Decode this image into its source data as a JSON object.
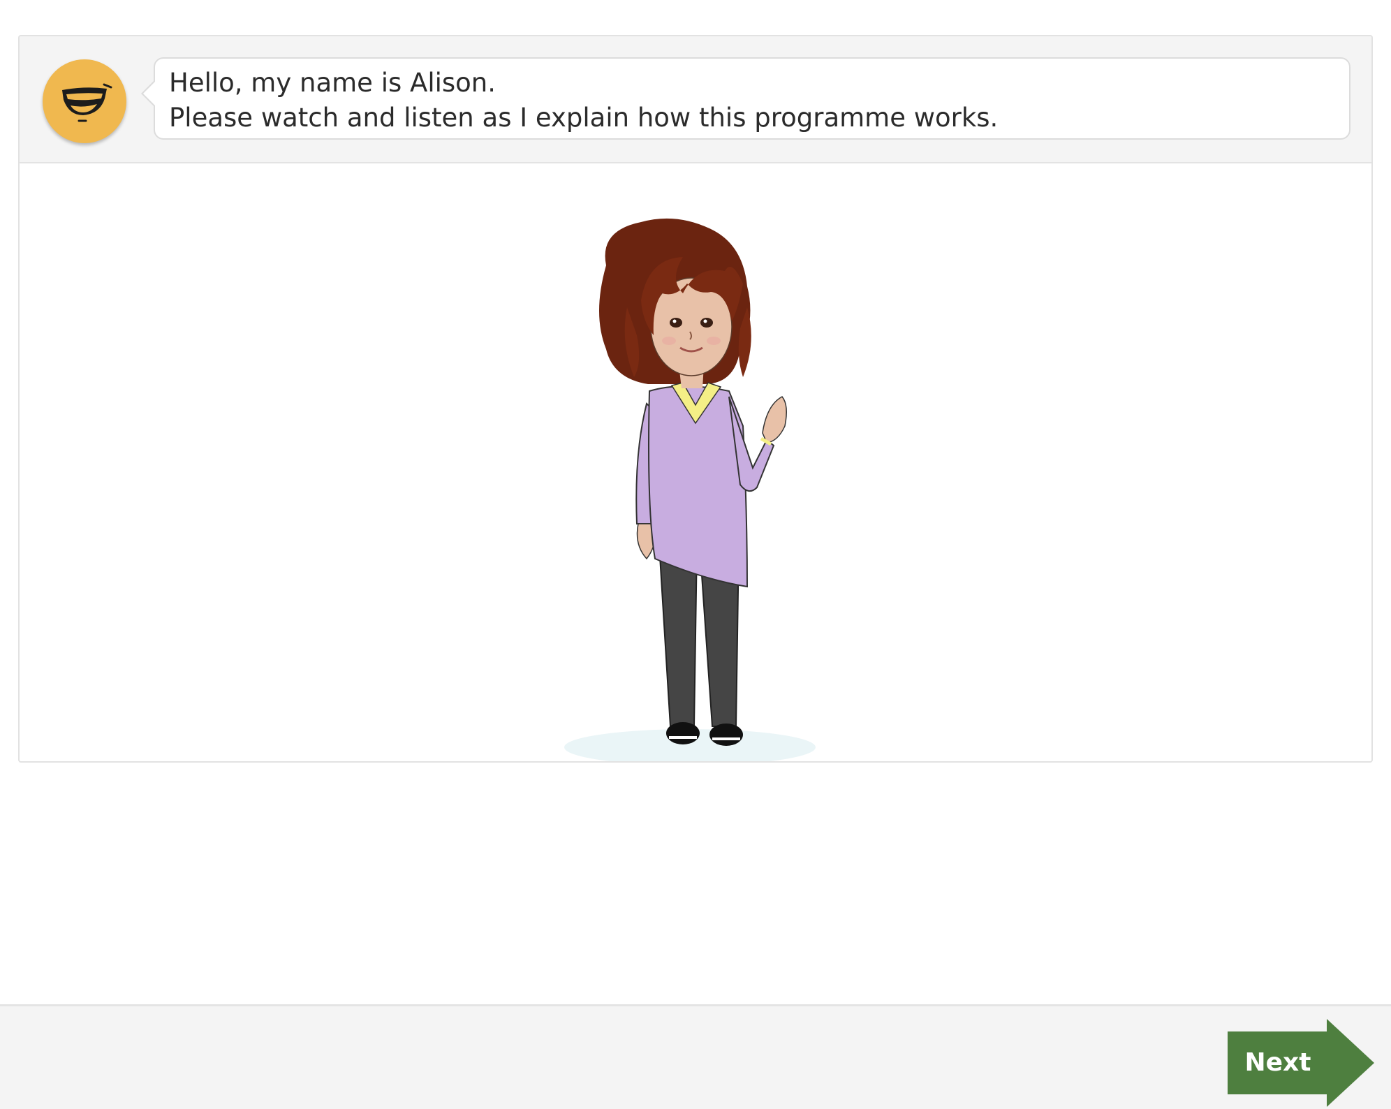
{
  "narration": {
    "avatar_icon": "speaking-mouth-icon",
    "line1": "Hello, my name is Alison.",
    "line2": "Please watch and listen as I explain how this programme works."
  },
  "illustration": {
    "character": "girl-waving-illustration"
  },
  "footer": {
    "next_label": "Next",
    "next_color": "#4e7f3f"
  },
  "colors": {
    "avatar": "#f0b84f",
    "header_bg": "#f4f4f4",
    "footer_bg": "#f4f4f4",
    "text": "#2b2b2b"
  }
}
